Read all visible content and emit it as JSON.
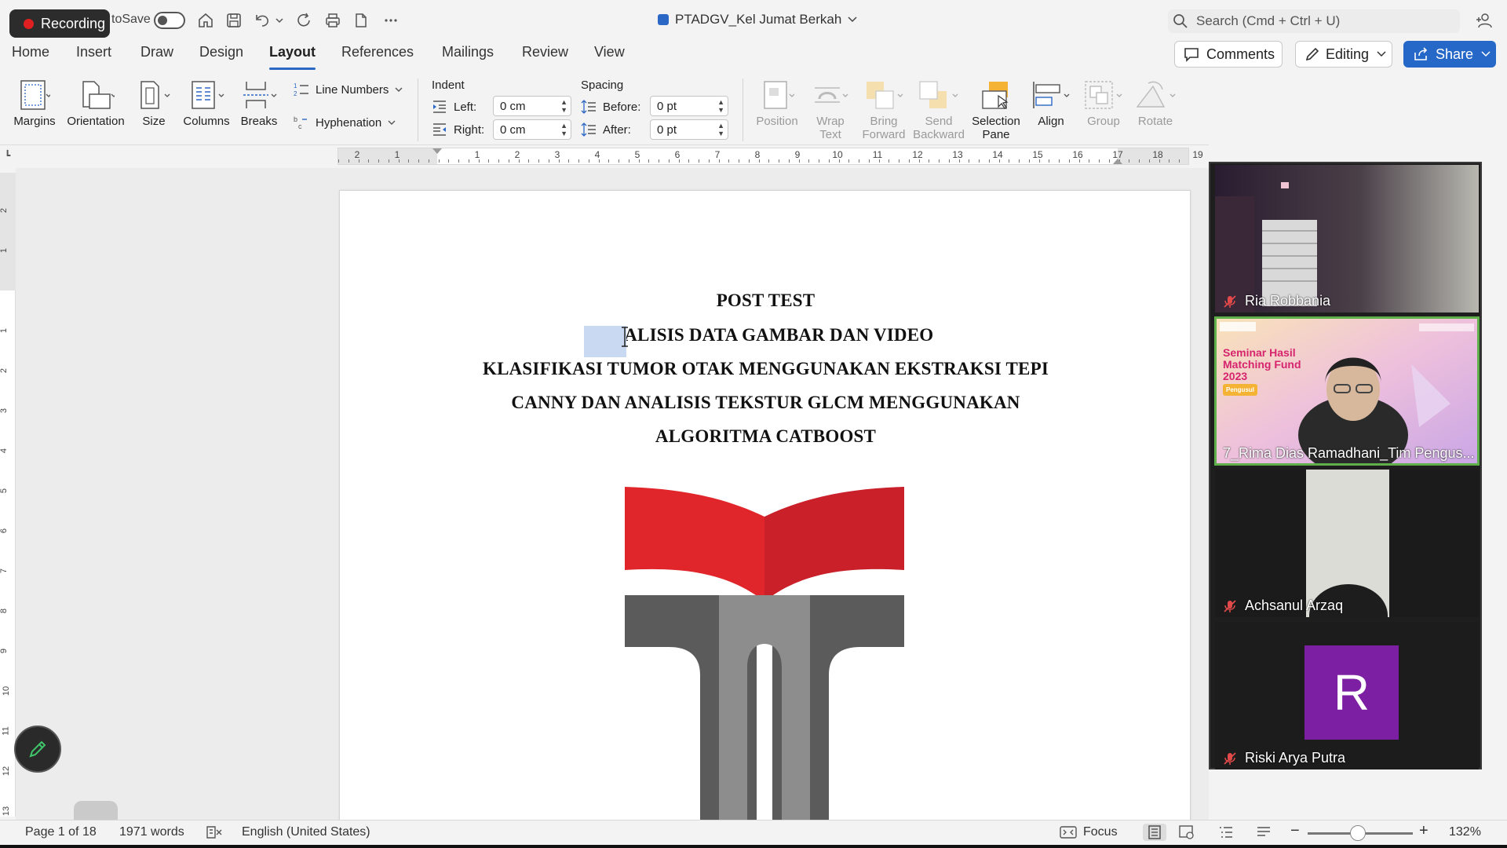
{
  "recording": {
    "label": "Recording"
  },
  "titlebar": {
    "autosave_label": "toSave",
    "document_title": "PTADGV_Kel Jumat Berkah",
    "search_label": "Search (Cmd + Ctrl + U)"
  },
  "tabs": [
    "Home",
    "Insert",
    "Draw",
    "Design",
    "Layout",
    "References",
    "Mailings",
    "Review",
    "View"
  ],
  "active_tab": "Layout",
  "actions": {
    "comments": "Comments",
    "editing": "Editing",
    "share": "Share"
  },
  "ribbon": {
    "margins": "Margins",
    "orientation": "Orientation",
    "size": "Size",
    "columns": "Columns",
    "breaks": "Breaks",
    "line_numbers": "Line Numbers",
    "hyphenation": "Hyphenation",
    "indent": {
      "title": "Indent",
      "left_label": "Left:",
      "left_value": "0 cm",
      "right_label": "Right:",
      "right_value": "0 cm"
    },
    "spacing": {
      "title": "Spacing",
      "before_label": "Before:",
      "before_value": "0 pt",
      "after_label": "After:",
      "after_value": "0 pt"
    },
    "position": "Position",
    "wrap_text": [
      "Wrap",
      "Text"
    ],
    "bring_forward": [
      "Bring",
      "Forward"
    ],
    "send_backward": [
      "Send",
      "Backward"
    ],
    "selection_pane": [
      "Selection",
      "Pane"
    ],
    "align": "Align",
    "group": "Group",
    "rotate": "Rotate"
  },
  "ruler": {
    "h_numbers": [
      "2",
      "1",
      "1",
      "2",
      "3",
      "4",
      "5",
      "6",
      "7",
      "8",
      "9",
      "10",
      "11",
      "12",
      "13",
      "14",
      "15",
      "16",
      "17",
      "18",
      "19"
    ],
    "v_numbers": [
      "2",
      "1",
      "1",
      "2",
      "3",
      "4",
      "5",
      "6",
      "7",
      "8",
      "9",
      "10",
      "11",
      "12",
      "13"
    ]
  },
  "document": {
    "lines": [
      "POST TEST",
      "ANALISIS DATA GAMBAR DAN VIDEO",
      "KLASIFIKASI TUMOR OTAK MENGGUNAKAN EKSTRAKSI TEPI",
      "CANNY DAN ANALISIS TEKSTUR GLCM MENGGUNAKAN",
      "ALGORITMA CATBOOST"
    ],
    "selected_text": "ANA"
  },
  "participants": [
    {
      "name": "Ria Robbania"
    },
    {
      "name": "7_Rima Dias Ramadhani_Tim Pengus...",
      "banner": [
        "Seminar Hasil",
        "Matching Fund",
        "2023"
      ],
      "badge": "Pengusul"
    },
    {
      "name": "Achsanul Arzaq"
    },
    {
      "name": "Riski Arya Putra",
      "initial": "R"
    }
  ],
  "status": {
    "page": "Page 1 of 18",
    "words": "1971 words",
    "language": "English (United States)",
    "focus": "Focus",
    "zoom": "132%",
    "zoom_level": 0.48
  },
  "colors": {
    "accent": "#2b67c5",
    "logo_red": "#e0262b",
    "logo_gray": "#5b5b5b",
    "avatar": "#7d1fa2",
    "active_speaker": "#5fb04a"
  }
}
